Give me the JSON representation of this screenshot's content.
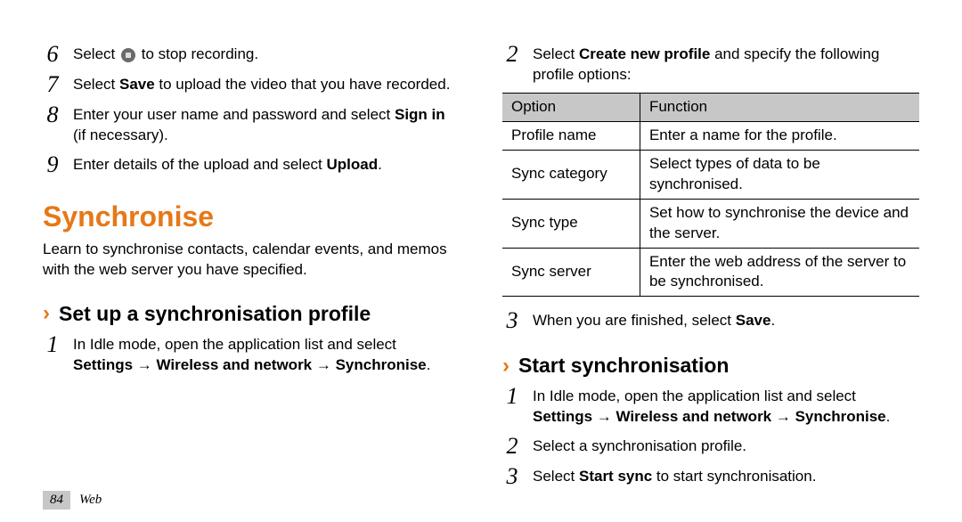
{
  "left": {
    "steps": [
      {
        "n": "6",
        "pre": "Select ",
        "post": " to stop recording.",
        "has_icon": true
      },
      {
        "n": "7",
        "html": "Select <b>Save</b> to upload the video that you have recorded."
      },
      {
        "n": "8",
        "html": "Enter your user name and password and select <b>Sign in</b> (if necessary)."
      },
      {
        "n": "9",
        "html": "Enter details of the upload and select <b>Upload</b>."
      }
    ],
    "section_title": "Synchronise",
    "section_desc": "Learn to synchronise contacts, calendar events, and memos with the web server you have specified.",
    "sub_title": "Set up a synchronisation profile",
    "sub_steps": [
      {
        "n": "1",
        "html": "In Idle mode, open the application list and select <b>Settings</b> → <b>Wireless and network</b> → <b>Synchronise</b>."
      }
    ]
  },
  "right": {
    "pre_steps": [
      {
        "n": "2",
        "html": "Select <b>Create new profile</b> and specify the following profile options:"
      }
    ],
    "table": {
      "headers": [
        "Option",
        "Function"
      ],
      "rows": [
        [
          "Profile name",
          "Enter a name for the profile."
        ],
        [
          "Sync category",
          "Select types of data to be synchronised."
        ],
        [
          "Sync type",
          "Set how to synchronise the device and the server."
        ],
        [
          "Sync server",
          "Enter the web address of the server to be synchronised."
        ]
      ]
    },
    "post_steps": [
      {
        "n": "3",
        "html": "When you are finished, select <b>Save</b>."
      }
    ],
    "sub_title": "Start synchronisation",
    "start_steps": [
      {
        "n": "1",
        "html": "In Idle mode, open the application list and select <b>Settings</b> → <b>Wireless and network</b> → <b>Synchronise</b>."
      },
      {
        "n": "2",
        "html": "Select a synchronisation profile."
      },
      {
        "n": "3",
        "html": "Select <b>Start sync</b> to start synchronisation."
      }
    ]
  },
  "footer": {
    "page_num": "84",
    "label": "Web"
  }
}
